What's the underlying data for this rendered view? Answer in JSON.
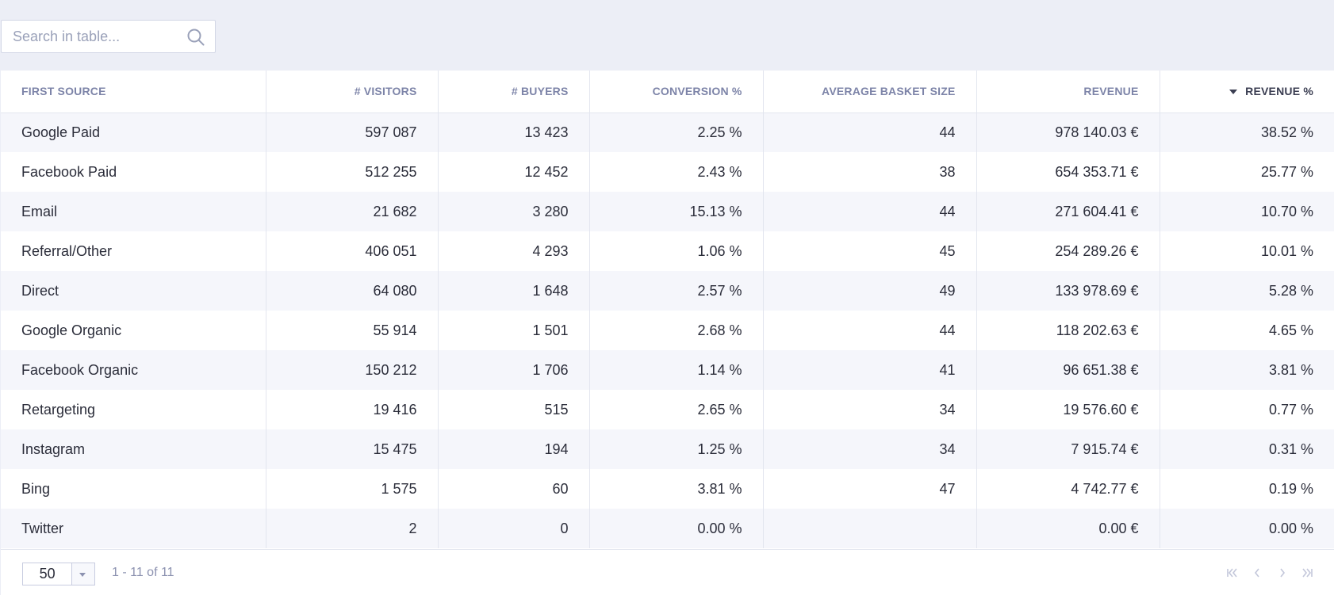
{
  "search": {
    "placeholder": "Search in table..."
  },
  "table": {
    "columns": [
      {
        "label": "First source",
        "align": "left"
      },
      {
        "label": "# Visitors",
        "align": "right"
      },
      {
        "label": "# Buyers",
        "align": "right"
      },
      {
        "label": "Conversion %",
        "align": "right"
      },
      {
        "label": "Average basket size",
        "align": "right"
      },
      {
        "label": "Revenue",
        "align": "right"
      },
      {
        "label": "Revenue %",
        "align": "right",
        "sorted": "desc"
      }
    ],
    "rows": [
      [
        "Google Paid",
        "597 087",
        "13 423",
        "2.25 %",
        "44",
        "978 140.03 €",
        "38.52 %"
      ],
      [
        "Facebook Paid",
        "512 255",
        "12 452",
        "2.43 %",
        "38",
        "654 353.71 €",
        "25.77 %"
      ],
      [
        "Email",
        "21 682",
        "3 280",
        "15.13 %",
        "44",
        "271 604.41 €",
        "10.70 %"
      ],
      [
        "Referral/Other",
        "406 051",
        "4 293",
        "1.06 %",
        "45",
        "254 289.26 €",
        "10.01 %"
      ],
      [
        "Direct",
        "64 080",
        "1 648",
        "2.57 %",
        "49",
        "133 978.69 €",
        "5.28 %"
      ],
      [
        "Google Organic",
        "55 914",
        "1 501",
        "2.68 %",
        "44",
        "118 202.63 €",
        "4.65 %"
      ],
      [
        "Facebook Organic",
        "150 212",
        "1 706",
        "1.14 %",
        "41",
        "96 651.38 €",
        "3.81 %"
      ],
      [
        "Retargeting",
        "19 416",
        "515",
        "2.65 %",
        "34",
        "19 576.60 €",
        "0.77 %"
      ],
      [
        "Instagram",
        "15 475",
        "194",
        "1.25 %",
        "34",
        "7 915.74 €",
        "0.31 %"
      ],
      [
        "Bing",
        "1 575",
        "60",
        "3.81 %",
        "47",
        "4 742.77 €",
        "0.19 %"
      ],
      [
        "Twitter",
        "2",
        "0",
        "0.00 %",
        "",
        "0.00 €",
        "0.00 %"
      ]
    ]
  },
  "pagination": {
    "page_size": "50",
    "range_text": "1 - 11 of 11",
    "buttons": [
      "first-page-icon",
      "prev-page-icon",
      "next-page-icon",
      "last-page-icon"
    ]
  },
  "colors": {
    "background": "#eceef6",
    "header_text": "#7d84a8",
    "row_alt": "#f5f6fb",
    "border": "#e3e6ef"
  }
}
